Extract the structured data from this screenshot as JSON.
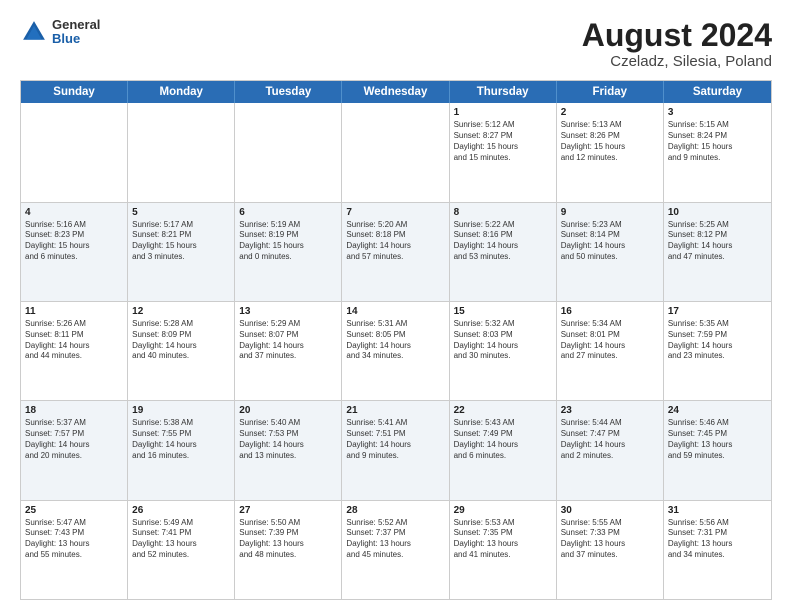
{
  "header": {
    "logo": {
      "general": "General",
      "blue": "Blue"
    },
    "title": "August 2024",
    "subtitle": "Czeladz, Silesia, Poland"
  },
  "calendar": {
    "weekdays": [
      "Sunday",
      "Monday",
      "Tuesday",
      "Wednesday",
      "Thursday",
      "Friday",
      "Saturday"
    ],
    "rows": [
      {
        "alt": false,
        "cells": [
          {
            "day": "",
            "info": ""
          },
          {
            "day": "",
            "info": ""
          },
          {
            "day": "",
            "info": ""
          },
          {
            "day": "",
            "info": ""
          },
          {
            "day": "1",
            "info": "Sunrise: 5:12 AM\nSunset: 8:27 PM\nDaylight: 15 hours\nand 15 minutes."
          },
          {
            "day": "2",
            "info": "Sunrise: 5:13 AM\nSunset: 8:26 PM\nDaylight: 15 hours\nand 12 minutes."
          },
          {
            "day": "3",
            "info": "Sunrise: 5:15 AM\nSunset: 8:24 PM\nDaylight: 15 hours\nand 9 minutes."
          }
        ]
      },
      {
        "alt": true,
        "cells": [
          {
            "day": "4",
            "info": "Sunrise: 5:16 AM\nSunset: 8:23 PM\nDaylight: 15 hours\nand 6 minutes."
          },
          {
            "day": "5",
            "info": "Sunrise: 5:17 AM\nSunset: 8:21 PM\nDaylight: 15 hours\nand 3 minutes."
          },
          {
            "day": "6",
            "info": "Sunrise: 5:19 AM\nSunset: 8:19 PM\nDaylight: 15 hours\nand 0 minutes."
          },
          {
            "day": "7",
            "info": "Sunrise: 5:20 AM\nSunset: 8:18 PM\nDaylight: 14 hours\nand 57 minutes."
          },
          {
            "day": "8",
            "info": "Sunrise: 5:22 AM\nSunset: 8:16 PM\nDaylight: 14 hours\nand 53 minutes."
          },
          {
            "day": "9",
            "info": "Sunrise: 5:23 AM\nSunset: 8:14 PM\nDaylight: 14 hours\nand 50 minutes."
          },
          {
            "day": "10",
            "info": "Sunrise: 5:25 AM\nSunset: 8:12 PM\nDaylight: 14 hours\nand 47 minutes."
          }
        ]
      },
      {
        "alt": false,
        "cells": [
          {
            "day": "11",
            "info": "Sunrise: 5:26 AM\nSunset: 8:11 PM\nDaylight: 14 hours\nand 44 minutes."
          },
          {
            "day": "12",
            "info": "Sunrise: 5:28 AM\nSunset: 8:09 PM\nDaylight: 14 hours\nand 40 minutes."
          },
          {
            "day": "13",
            "info": "Sunrise: 5:29 AM\nSunset: 8:07 PM\nDaylight: 14 hours\nand 37 minutes."
          },
          {
            "day": "14",
            "info": "Sunrise: 5:31 AM\nSunset: 8:05 PM\nDaylight: 14 hours\nand 34 minutes."
          },
          {
            "day": "15",
            "info": "Sunrise: 5:32 AM\nSunset: 8:03 PM\nDaylight: 14 hours\nand 30 minutes."
          },
          {
            "day": "16",
            "info": "Sunrise: 5:34 AM\nSunset: 8:01 PM\nDaylight: 14 hours\nand 27 minutes."
          },
          {
            "day": "17",
            "info": "Sunrise: 5:35 AM\nSunset: 7:59 PM\nDaylight: 14 hours\nand 23 minutes."
          }
        ]
      },
      {
        "alt": true,
        "cells": [
          {
            "day": "18",
            "info": "Sunrise: 5:37 AM\nSunset: 7:57 PM\nDaylight: 14 hours\nand 20 minutes."
          },
          {
            "day": "19",
            "info": "Sunrise: 5:38 AM\nSunset: 7:55 PM\nDaylight: 14 hours\nand 16 minutes."
          },
          {
            "day": "20",
            "info": "Sunrise: 5:40 AM\nSunset: 7:53 PM\nDaylight: 14 hours\nand 13 minutes."
          },
          {
            "day": "21",
            "info": "Sunrise: 5:41 AM\nSunset: 7:51 PM\nDaylight: 14 hours\nand 9 minutes."
          },
          {
            "day": "22",
            "info": "Sunrise: 5:43 AM\nSunset: 7:49 PM\nDaylight: 14 hours\nand 6 minutes."
          },
          {
            "day": "23",
            "info": "Sunrise: 5:44 AM\nSunset: 7:47 PM\nDaylight: 14 hours\nand 2 minutes."
          },
          {
            "day": "24",
            "info": "Sunrise: 5:46 AM\nSunset: 7:45 PM\nDaylight: 13 hours\nand 59 minutes."
          }
        ]
      },
      {
        "alt": false,
        "cells": [
          {
            "day": "25",
            "info": "Sunrise: 5:47 AM\nSunset: 7:43 PM\nDaylight: 13 hours\nand 55 minutes."
          },
          {
            "day": "26",
            "info": "Sunrise: 5:49 AM\nSunset: 7:41 PM\nDaylight: 13 hours\nand 52 minutes."
          },
          {
            "day": "27",
            "info": "Sunrise: 5:50 AM\nSunset: 7:39 PM\nDaylight: 13 hours\nand 48 minutes."
          },
          {
            "day": "28",
            "info": "Sunrise: 5:52 AM\nSunset: 7:37 PM\nDaylight: 13 hours\nand 45 minutes."
          },
          {
            "day": "29",
            "info": "Sunrise: 5:53 AM\nSunset: 7:35 PM\nDaylight: 13 hours\nand 41 minutes."
          },
          {
            "day": "30",
            "info": "Sunrise: 5:55 AM\nSunset: 7:33 PM\nDaylight: 13 hours\nand 37 minutes."
          },
          {
            "day": "31",
            "info": "Sunrise: 5:56 AM\nSunset: 7:31 PM\nDaylight: 13 hours\nand 34 minutes."
          }
        ]
      }
    ]
  }
}
